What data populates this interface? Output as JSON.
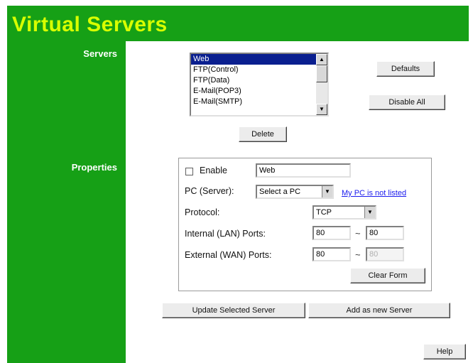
{
  "page": {
    "title": "Virtual Servers",
    "colors": {
      "brand_green": "#16a016",
      "title_yellow": "#d8ff00",
      "selection": "#0a1f8f",
      "link": "#1a1aee"
    }
  },
  "servers_section": {
    "label": "Servers",
    "list": {
      "items": [
        "Web",
        "FTP(Control)",
        "FTP(Data)",
        "E-Mail(POP3)",
        "E-Mail(SMTP)"
      ],
      "selected": "Web",
      "scroll_up_icon": "triangle-up-icon",
      "scroll_down_icon": "triangle-down-icon"
    },
    "delete_label": "Delete",
    "defaults_label": "Defaults",
    "disable_all_label": "Disable All"
  },
  "properties_section": {
    "label": "Properties",
    "enable_label": "Enable",
    "enable_checked": false,
    "name_value": "Web",
    "pc_label": "PC (Server):",
    "pc_select_value": "Select a PC",
    "not_listed_link": "My PC is not listed",
    "protocol_label": "Protocol:",
    "protocol_value": "TCP",
    "internal_label": "Internal (LAN) Ports:",
    "internal_from": "80",
    "internal_to": "80",
    "external_label": "External (WAN) Ports:",
    "external_from": "80",
    "external_to": "80",
    "range_separator": "~",
    "clear_form_label": "Clear Form"
  },
  "actions": {
    "update_label": "Update Selected Server",
    "add_label": "Add as new Server",
    "help_label": "Help"
  }
}
